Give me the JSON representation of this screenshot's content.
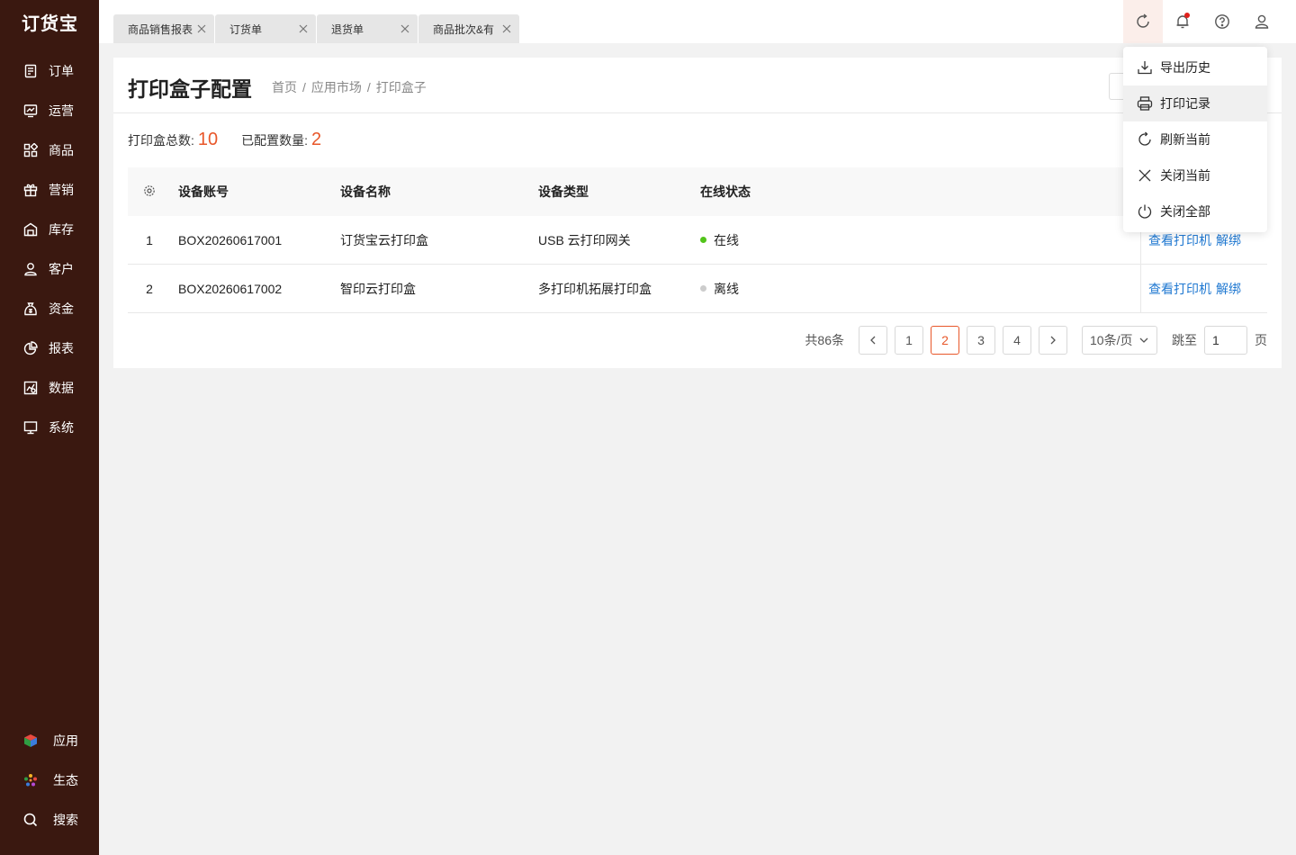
{
  "app": {
    "logo": "订货宝"
  },
  "sidebar": {
    "items": [
      {
        "label": "订单",
        "icon": "order-icon"
      },
      {
        "label": "运营",
        "icon": "operation-icon"
      },
      {
        "label": "商品",
        "icon": "product-icon"
      },
      {
        "label": "营销",
        "icon": "gift-icon"
      },
      {
        "label": "库存",
        "icon": "warehouse-icon"
      },
      {
        "label": "客户",
        "icon": "user-icon"
      },
      {
        "label": "资金",
        "icon": "money-bag-icon"
      },
      {
        "label": "报表",
        "icon": "pie-chart-icon"
      },
      {
        "label": "数据",
        "icon": "data-analysis-icon"
      },
      {
        "label": "系统",
        "icon": "monitor-icon"
      }
    ],
    "bottom": [
      {
        "label": "应用",
        "icon": "cube-icon"
      },
      {
        "label": "生态",
        "icon": "flower-icon"
      },
      {
        "label": "搜索",
        "icon": "search-icon"
      }
    ]
  },
  "tabs": [
    {
      "label": "商品销售报表"
    },
    {
      "label": "订货单"
    },
    {
      "label": "退货单"
    },
    {
      "label": "商品批次&有"
    }
  ],
  "page": {
    "title": "打印盒子配置",
    "breadcrumb": [
      "首页",
      "应用市场",
      "打印盒子"
    ]
  },
  "stats": {
    "total_label": "打印盒总数:",
    "total_value": "10",
    "configured_label": "已配置数量:",
    "configured_value": "2"
  },
  "table": {
    "headers": [
      "设备账号",
      "设备名称",
      "设备类型",
      "在线状态"
    ],
    "rows": [
      {
        "index": "1",
        "account": "BOX20260617001",
        "name": "订货宝云打印盒",
        "type": "USB 云打印网关",
        "status": "在线",
        "status_color": "#52c41a",
        "action1": "查看打印机",
        "action2": "解绑"
      },
      {
        "index": "2",
        "account": "BOX20260617002",
        "name": "智印云打印盒",
        "type": "多打印机拓展打印盒",
        "status": "离线",
        "status_color": "#cccccc",
        "action1": "查看打印机",
        "action2": "解绑"
      }
    ]
  },
  "pagination": {
    "total": "共86条",
    "pages": [
      "1",
      "2",
      "3",
      "4"
    ],
    "current": "2",
    "page_size": "10条/页",
    "jump_label": "跳至",
    "jump_value": "1",
    "page_suffix": "页"
  },
  "dropdown": {
    "items": [
      {
        "label": "导出历史",
        "icon": "download-icon"
      },
      {
        "label": "打印记录",
        "icon": "printer-icon"
      },
      {
        "label": "刷新当前",
        "icon": "refresh-icon"
      },
      {
        "label": "关闭当前",
        "icon": "close-icon"
      },
      {
        "label": "关闭全部",
        "icon": "power-icon"
      }
    ]
  },
  "colors": {
    "sidebar_bg": "#3a1810",
    "accent": "#e8572a",
    "link": "#1f78d1",
    "online": "#52c41a",
    "offline": "#cccccc"
  }
}
